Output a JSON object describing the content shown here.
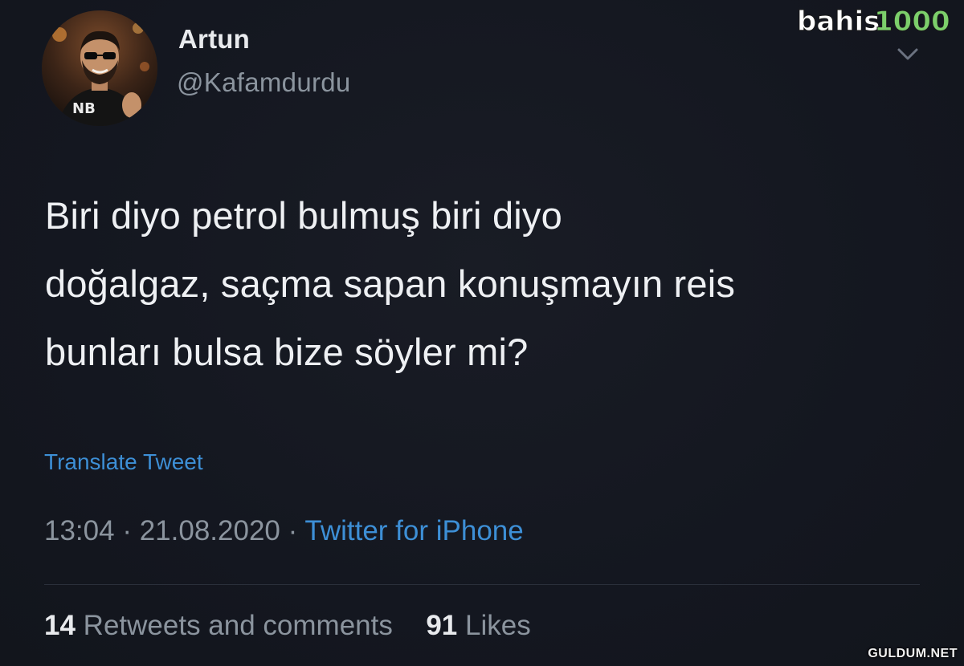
{
  "author": {
    "name": "Artun",
    "handle": "@Kafamdurdu"
  },
  "tweet": {
    "lines": [
      "Biri diyo petrol bulmuş biri diyo",
      "doğalgaz, saçma sapan konuşmayın reis",
      "bunları bulsa bize söyler mi?"
    ],
    "translate_label": "Translate Tweet"
  },
  "meta": {
    "time": "13:04",
    "date": "21.08.2020",
    "separator": "·",
    "source": "Twitter for iPhone"
  },
  "stats": {
    "retweets_count": "14",
    "retweets_label": "Retweets and comments",
    "likes_count": "91",
    "likes_label": "Likes"
  },
  "watermarks": {
    "logo_text": "bahis1000",
    "site": "GULDUM.NET"
  },
  "icons": {
    "caret": "chevron-down-icon",
    "avatar": "avatar-photo"
  },
  "colors": {
    "background": "#14171f",
    "link": "#3d8fd6",
    "secondary_text": "#8b949e",
    "primary_text": "#eef0f3"
  }
}
